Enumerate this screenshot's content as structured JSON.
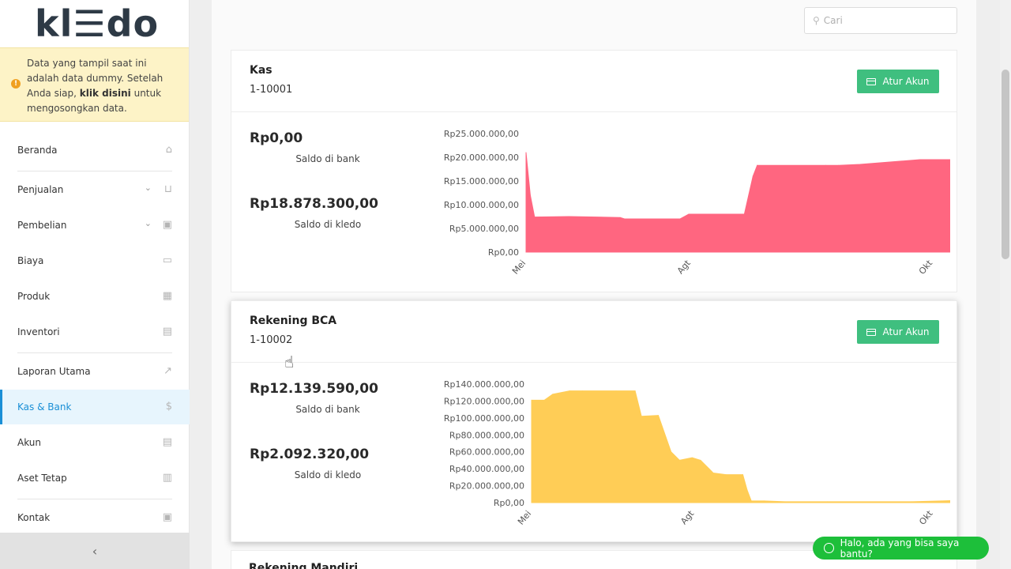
{
  "app": {
    "logo": "kl☰do"
  },
  "notice": {
    "text_before": "Data yang tampil saat ini adalah data dummy. Setelah Anda siap, ",
    "link": "klik disini",
    "text_after": " untuk mengosongkan data."
  },
  "sidebar": {
    "items": [
      {
        "label": "Beranda",
        "icon": "home-icon"
      },
      {
        "label": "Penjualan",
        "icon": "basket-icon",
        "expandable": true
      },
      {
        "label": "Pembelian",
        "icon": "bag-icon",
        "expandable": true
      },
      {
        "label": "Biaya",
        "icon": "credit-card-icon"
      },
      {
        "label": "Produk",
        "icon": "boxes-icon"
      },
      {
        "label": "Inventori",
        "icon": "warehouse-icon"
      },
      {
        "label": "Laporan Utama",
        "icon": "chart-icon"
      },
      {
        "label": "Kas & Bank",
        "icon": "dollar-icon",
        "active": true
      },
      {
        "label": "Akun",
        "icon": "list-icon"
      },
      {
        "label": "Aset Tetap",
        "icon": "building-icon"
      },
      {
        "label": "Kontak",
        "icon": "contact-card-icon"
      }
    ],
    "collapse_symbol": "‹"
  },
  "search": {
    "placeholder": "Cari"
  },
  "accounts": [
    {
      "name": "Kas",
      "code": "1-10001",
      "button": "Atur Akun",
      "bank_balance": "Rp0,00",
      "bank_label": "Saldo di bank",
      "kledo_balance": "Rp18.878.300,00",
      "kledo_label": "Saldo di kledo"
    },
    {
      "name": "Rekening BCA",
      "code": "1-10002",
      "button": "Atur Akun",
      "bank_balance": "Rp12.139.590,00",
      "bank_label": "Saldo di bank",
      "kledo_balance": "Rp2.092.320,00",
      "kledo_label": "Saldo di kledo"
    },
    {
      "name": "Rekening Mandiri"
    }
  ],
  "chart_data": [
    {
      "type": "area",
      "color": "#ff6680",
      "x_ticks": [
        "Mei",
        "Agt",
        "Okt"
      ],
      "y_ticks": [
        "Rp0,00",
        "Rp5.000.000,00",
        "Rp10.000.000,00",
        "Rp15.000.000,00",
        "Rp20.000.000,00",
        "Rp25.000.000,00"
      ],
      "ylim": [
        0,
        25000000
      ],
      "x": [
        0,
        0.01,
        0.02,
        0.1,
        0.22,
        0.23,
        0.36,
        0.38,
        0.51,
        0.53,
        0.54,
        0.7,
        0.73,
        0.78,
        0.92,
        1.0
      ],
      "values": [
        21000000,
        12000000,
        7400000,
        7500000,
        7300000,
        7000000,
        7000000,
        8000000,
        8000000,
        16000000,
        18300000,
        18300000,
        18300000,
        18500000,
        19500000,
        19500000
      ]
    },
    {
      "type": "area",
      "color": "#ffcd56",
      "x_ticks": [
        "Mei",
        "Agt",
        "Okt"
      ],
      "y_ticks": [
        "Rp0,00",
        "Rp20.000.000,00",
        "Rp40.000.000,00",
        "Rp60.000.000,00",
        "Rp80.000.000,00",
        "Rp100.000.000,00",
        "Rp120.000.000,00",
        "Rp140.000.000,00"
      ],
      "ylim": [
        0,
        140000000
      ],
      "x": [
        0,
        0.03,
        0.05,
        0.09,
        0.12,
        0.2,
        0.245,
        0.26,
        0.3,
        0.33,
        0.35,
        0.38,
        0.4,
        0.42,
        0.43,
        0.46,
        0.5,
        0.51,
        0.52,
        0.55,
        0.6,
        0.7,
        0.9,
        0.97,
        1.0
      ],
      "values": [
        121000000,
        121000000,
        128000000,
        132000000,
        132000000,
        132000000,
        132000000,
        102000000,
        103000000,
        60000000,
        50000000,
        53000000,
        50000000,
        40000000,
        35000000,
        33000000,
        33000000,
        15000000,
        2000000,
        2000000,
        1000000,
        1000000,
        1000000,
        2000000,
        2500000
      ]
    }
  ],
  "whatsapp": {
    "label": "Halo, ada yang bisa saya bantu?"
  }
}
